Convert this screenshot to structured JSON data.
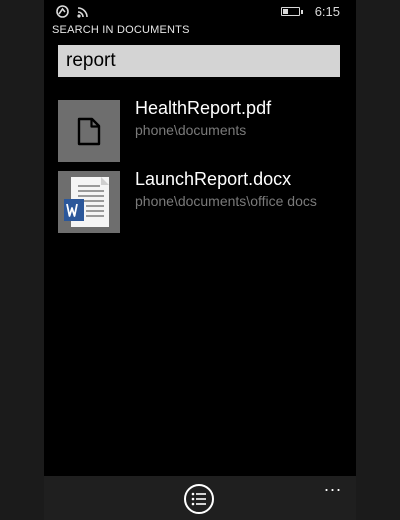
{
  "status_bar": {
    "time": "6:15",
    "battery_level": 0.3,
    "icons": [
      "notification-icon",
      "wifi-signal-icon",
      "battery-icon"
    ]
  },
  "header": {
    "title": "SEARCH IN DOCUMENTS"
  },
  "search": {
    "value": "report"
  },
  "results": [
    {
      "name": "HealthReport.pdf",
      "path": "phone\\documents",
      "icon": "file-icon"
    },
    {
      "name": "LaunchReport.docx",
      "path": "phone\\documents\\office docs",
      "icon": "word-document-icon"
    }
  ],
  "app_bar": {
    "primary_icon": "list-icon",
    "more_label": "..."
  },
  "colors": {
    "background": "#000000",
    "search_box": "#d4d4d4",
    "thumb_gray": "#6e6e6e",
    "word_blue": "#2b579a",
    "secondary_text": "#7a7a7a"
  }
}
